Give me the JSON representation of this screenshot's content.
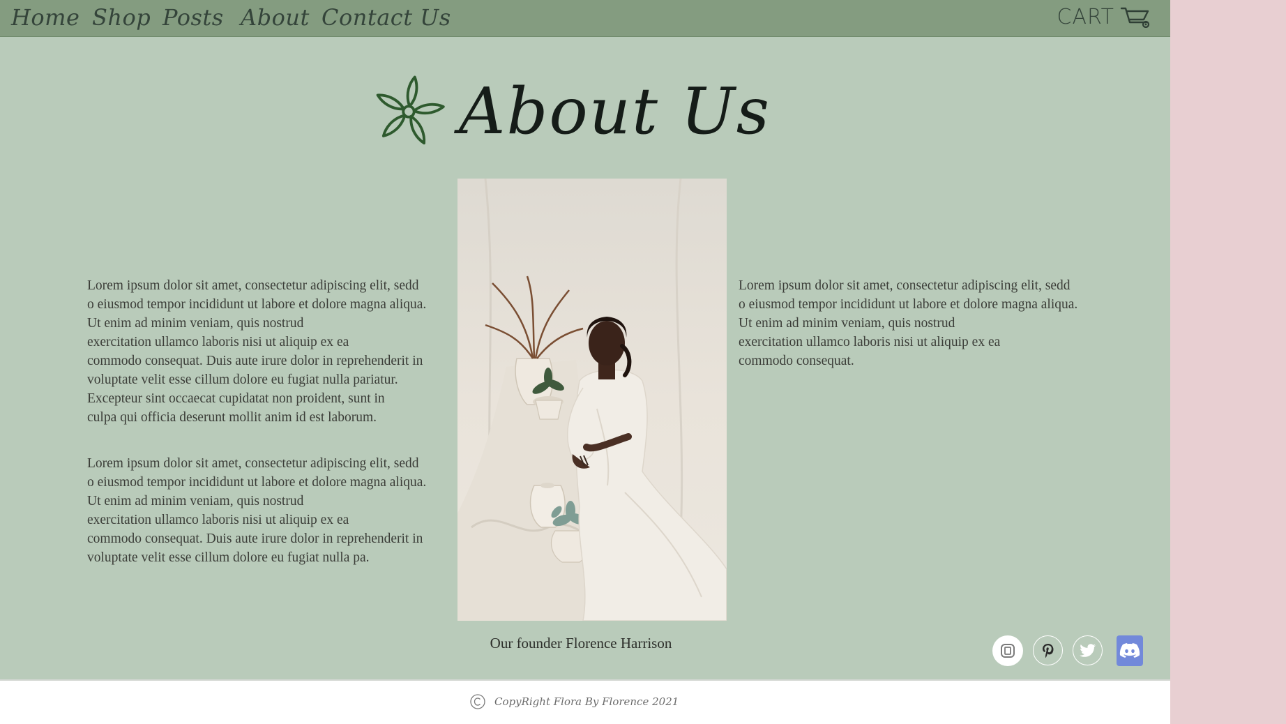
{
  "nav": {
    "links": [
      "Home",
      "Shop",
      "Posts",
      "About",
      "Contact Us"
    ],
    "cart_label": "CART"
  },
  "page": {
    "title": "About Us"
  },
  "content": {
    "left_paragraph_1": "Lorem ipsum dolor sit amet, consectetur adipiscing elit, sedd\no eiusmod tempor incididunt ut labore et dolore magna aliqua.\nUt enim ad minim veniam, quis nostrud\nexercitation ullamco laboris nisi ut aliquip ex ea\ncommodo consequat. Duis aute irure dolor in reprehenderit in\nvoluptate velit esse cillum dolore eu fugiat nulla pariatur.\nExcepteur sint occaecat cupidatat non proident, sunt in\nculpa qui officia deserunt mollit anim id est laborum.",
    "left_paragraph_2": "Lorem ipsum dolor sit amet, consectetur adipiscing elit, sedd\no eiusmod tempor incididunt ut labore et dolore magna aliqua.\nUt enim ad minim veniam, quis nostrud\nexercitation ullamco laboris nisi ut aliquip ex ea\ncommodo consequat. Duis aute irure dolor in reprehenderit in\nvoluptate velit esse cillum dolore eu fugiat nulla pa.",
    "right_paragraph_1": "Lorem ipsum dolor sit amet, consectetur adipiscing elit, sedd\no eiusmod tempor incididunt ut labore et dolore magna aliqua.\nUt enim ad minim veniam, quis nostrud\nexercitation ullamco laboris nisi ut aliquip ex ea\ncommodo consequat.",
    "photo_caption": "Our founder Florence Harrison"
  },
  "social": {
    "icons": [
      "instagram-icon",
      "pinterest-icon",
      "twitter-icon",
      "discord-icon"
    ]
  },
  "footer": {
    "copyright_symbol": "©",
    "text": "CopyRight Flora By Florence 2021"
  },
  "colors": {
    "page_background": "#b9cbba",
    "navbar": "#849c80",
    "side_panel": "#e8cfd2",
    "footer": "#ffffff",
    "discord": "#7289da",
    "flower_icon": "#2e5a2e"
  }
}
